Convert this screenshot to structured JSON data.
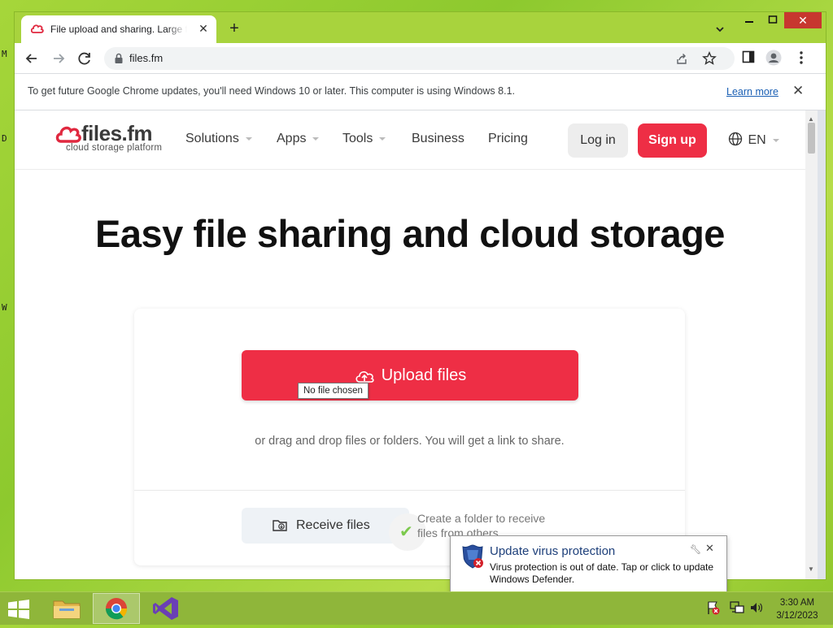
{
  "desktop": {
    "glyphs": [
      "M",
      "D",
      "W"
    ]
  },
  "browser": {
    "tab_title": "File upload and sharing. Large files",
    "url": "files.fm",
    "infobar": {
      "message": "To get future Google Chrome updates, you'll need Windows 10 or later. This computer is using Windows 8.1.",
      "learn_more": "Learn more"
    }
  },
  "site": {
    "logo_word": "files.fm",
    "logo_tagline": "cloud storage platform",
    "nav": [
      {
        "label": "Solutions"
      },
      {
        "label": "Apps"
      },
      {
        "label": "Tools"
      },
      {
        "label": "Business"
      },
      {
        "label": "Pricing"
      }
    ],
    "login": "Log in",
    "signup": "Sign up",
    "lang": "EN",
    "hero": "Easy file sharing and cloud storage",
    "upload_button": "Upload files",
    "tooltip": "No file chosen",
    "drag_text": "or drag and drop files or folders. You will get a link to share.",
    "receive_button": "Receive files",
    "receive_desc": "Create a folder to receive files from others",
    "colors": {
      "brand_red": "#ee2e45"
    }
  },
  "toast": {
    "title": "Update virus protection",
    "body": "Virus protection is out of date. Tap or click to update Windows Defender."
  },
  "taskbar": {
    "time": "3:30 AM",
    "date": "3/12/2023"
  }
}
